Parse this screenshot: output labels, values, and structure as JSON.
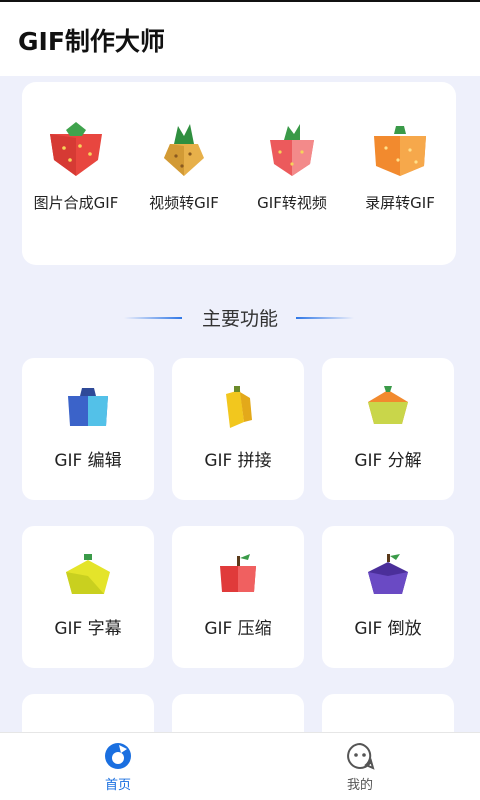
{
  "app": {
    "title": "GIF制作大师"
  },
  "top_tools": [
    {
      "label": "图片合成GIF",
      "icon": "strawberry-icon"
    },
    {
      "label": "视频转GIF",
      "icon": "pineapple-icon"
    },
    {
      "label": "GIF转视频",
      "icon": "strawberry-icon"
    },
    {
      "label": "录屏转GIF",
      "icon": "orange-icon"
    }
  ],
  "section": {
    "title": "主要功能"
  },
  "features": [
    {
      "label": "GIF 编辑",
      "icon": "blueberry-icon"
    },
    {
      "label": "GIF 拼接",
      "icon": "banana-icon"
    },
    {
      "label": "GIF 分解",
      "icon": "orange-icon"
    },
    {
      "label": "GIF 字幕",
      "icon": "lemon-icon"
    },
    {
      "label": "GIF 压缩",
      "icon": "apple-icon"
    },
    {
      "label": "GIF 倒放",
      "icon": "plum-icon"
    }
  ],
  "tabbar": {
    "home": {
      "label": "首页",
      "icon": "home-icon",
      "active": true
    },
    "mine": {
      "label": "我的",
      "icon": "chat-face-icon",
      "active": false
    }
  },
  "colors": {
    "accent": "#1a6fe0",
    "background": "#eef0fb"
  }
}
